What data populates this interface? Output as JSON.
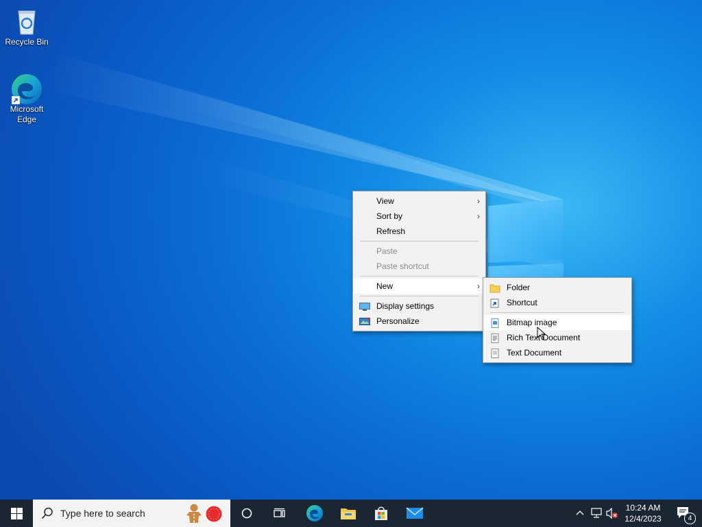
{
  "desktop": {
    "icons": [
      {
        "label": "Recycle Bin",
        "icon": "recycle-bin-icon"
      },
      {
        "label": "Microsoft Edge",
        "icon": "edge-icon"
      }
    ]
  },
  "context_menu": {
    "items": [
      {
        "label": "View",
        "submenu": true
      },
      {
        "label": "Sort by",
        "submenu": true
      },
      {
        "label": "Refresh"
      },
      {
        "label": "Paste",
        "disabled": true
      },
      {
        "label": "Paste shortcut",
        "disabled": true
      },
      {
        "label": "New",
        "submenu": true,
        "highlighted": true
      },
      {
        "label": "Display settings",
        "icon": "display-settings-icon"
      },
      {
        "label": "Personalize",
        "icon": "personalize-icon"
      }
    ]
  },
  "new_submenu": {
    "items": [
      {
        "label": "Folder",
        "icon": "folder-icon"
      },
      {
        "label": "Shortcut",
        "icon": "shortcut-icon"
      },
      {
        "label": "Bitmap image",
        "icon": "bitmap-icon",
        "highlighted": true
      },
      {
        "label": "Rich Text Document",
        "icon": "rich-text-icon"
      },
      {
        "label": "Text Document",
        "icon": "text-document-icon"
      }
    ]
  },
  "taskbar": {
    "search_placeholder": "Type here to search",
    "clock_time": "10:24 AM",
    "clock_date": "12/4/2023",
    "notification_count": "4",
    "apps": [
      "cortana-icon",
      "task-view-icon",
      "edge-icon",
      "file-explorer-icon",
      "store-icon",
      "mail-icon"
    ]
  },
  "colors": {
    "desktop_blue": "#0b6fd6",
    "taskbar": "#1a2733",
    "menu_bg": "#f2f2f2"
  }
}
